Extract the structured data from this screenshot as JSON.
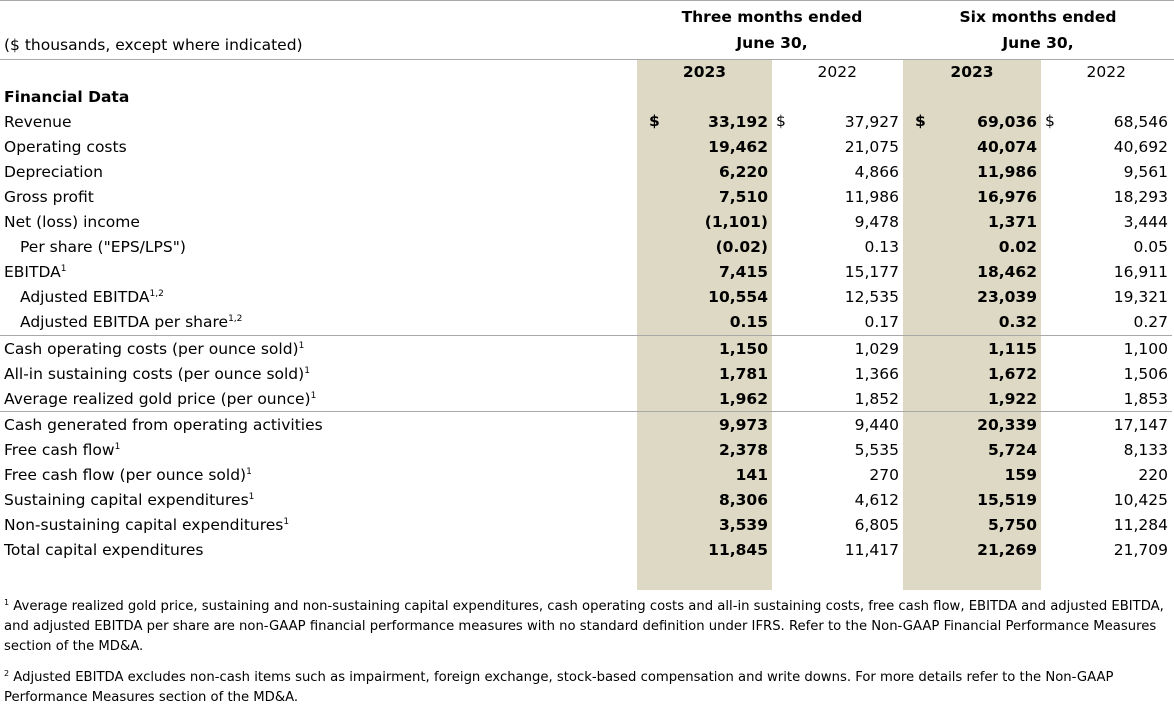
{
  "header": {
    "units_note": "($ thousands, except where indicated)",
    "group1_line1": "Three months ended",
    "group1_line2": "June 30,",
    "group2_line1": "Six months ended",
    "group2_line2": "June 30,",
    "years": [
      "2023",
      "2022",
      "2023",
      "2022"
    ]
  },
  "currency_symbol": "$",
  "section_title": "Financial Data",
  "rows": [
    {
      "label": "Revenue",
      "sup": "",
      "values": [
        "33,192",
        "37,927",
        "69,036",
        "68,546"
      ]
    },
    {
      "label": "Operating costs",
      "sup": "",
      "values": [
        "19,462",
        "21,075",
        "40,074",
        "40,692"
      ]
    },
    {
      "label": "Depreciation",
      "sup": "",
      "values": [
        "6,220",
        "4,866",
        "11,986",
        "9,561"
      ]
    },
    {
      "label": "Gross profit",
      "sup": "",
      "values": [
        "7,510",
        "11,986",
        "16,976",
        "18,293"
      ]
    },
    {
      "label": "Net (loss) income",
      "sup": "",
      "values": [
        "(1,101)",
        "9,478",
        "1,371",
        "3,444"
      ]
    },
    {
      "label": "Per share (\"EPS/LPS\")",
      "sup": "",
      "values": [
        "(0.02)",
        "0.13",
        "0.02",
        "0.05"
      ]
    },
    {
      "label": "EBITDA",
      "sup": "1",
      "values": [
        "7,415",
        "15,177",
        "18,462",
        "16,911"
      ]
    },
    {
      "label": "Adjusted EBITDA",
      "sup": "1,2",
      "values": [
        "10,554",
        "12,535",
        "23,039",
        "19,321"
      ]
    },
    {
      "label": "Adjusted EBITDA per share",
      "sup": "1,2",
      "values": [
        "0.15",
        "0.17",
        "0.32",
        "0.27"
      ]
    },
    {
      "label": "Cash operating costs (per ounce sold)",
      "sup": "1",
      "values": [
        "1,150",
        "1,029",
        "1,115",
        "1,100"
      ]
    },
    {
      "label": "All-in sustaining costs (per ounce sold)",
      "sup": "1",
      "values": [
        "1,781",
        "1,366",
        "1,672",
        "1,506"
      ]
    },
    {
      "label": "Average realized gold price (per ounce)",
      "sup": "1",
      "values": [
        "1,962",
        "1,852",
        "1,922",
        "1,853"
      ]
    },
    {
      "label": "Cash generated from operating activities",
      "sup": "",
      "values": [
        "9,973",
        "9,440",
        "20,339",
        "17,147"
      ]
    },
    {
      "label": "Free cash flow",
      "sup": "1",
      "values": [
        "2,378",
        "5,535",
        "5,724",
        "8,133"
      ]
    },
    {
      "label": "Free cash flow (per ounce sold)",
      "sup": "1",
      "values": [
        "141",
        "270",
        "159",
        "220"
      ]
    },
    {
      "label": "Sustaining capital expenditures",
      "sup": "1",
      "values": [
        "8,306",
        "4,612",
        "15,519",
        "10,425"
      ]
    },
    {
      "label": "Non-sustaining capital expenditures",
      "sup": "1",
      "values": [
        "3,539",
        "6,805",
        "5,750",
        "11,284"
      ]
    },
    {
      "label": "Total capital expenditures",
      "sup": "",
      "values": [
        "11,845",
        "11,417",
        "21,269",
        "21,709"
      ]
    }
  ],
  "footnotes": [
    {
      "mark": "1",
      "text": "Average realized gold price, sustaining and non-sustaining capital expenditures, cash operating costs and all-in sustaining costs, free cash flow, EBITDA and adjusted EBITDA, and adjusted EBITDA per share are non-GAAP financial performance measures with no standard definition under IFRS. Refer to the Non-GAAP Financial Performance Measures section of the MD&A."
    },
    {
      "mark": "2",
      "text": "Adjusted EBITDA excludes non-cash items such as impairment, foreign exchange, stock-based compensation and write downs. For more details refer to the Non-GAAP Performance Measures section of the MD&A."
    }
  ],
  "colors": {
    "highlight": "#ddd9c4",
    "rule": "#a8a8a8"
  }
}
